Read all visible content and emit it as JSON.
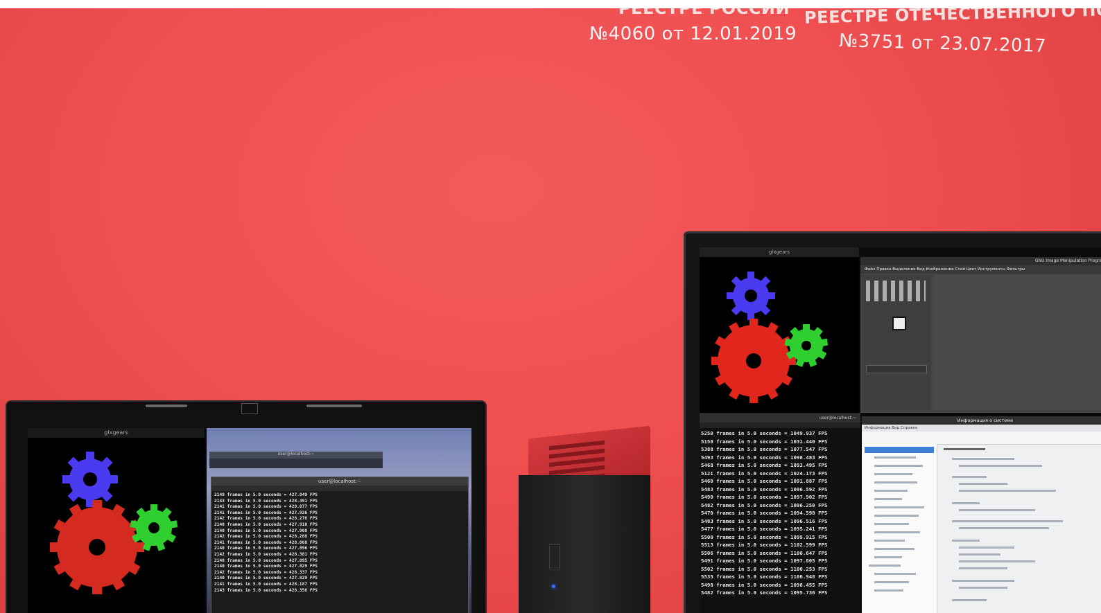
{
  "banner": {
    "left": {
      "cut_text": "РЕЕСТРЕ РОССИИ",
      "reg": "№4060 от 12.01.2019"
    },
    "right": {
      "cut_text": "РЕЕСТРЕ ОТЕЧЕСТВЕННОГО ПО",
      "reg": "№3751 от 23.07.2017"
    }
  },
  "left_screen": {
    "gears_title": "glxgears",
    "terminal_title": "user@localhost:~",
    "lines": [
      "2149 frames in 5.0 seconds = 427.849 FPS",
      "2143 frames in 5.0 seconds = 428.491 FPS",
      "2141 frames in 5.0 seconds = 428.077 FPS",
      "2141 frames in 5.0 seconds = 427.926 FPS",
      "2142 frames in 5.0 seconds = 428.276 FPS",
      "2140 frames in 5.0 seconds = 427.910 FPS",
      "2140 frames in 5.0 seconds = 427.908 FPS",
      "2142 frames in 5.0 seconds = 428.288 FPS",
      "2141 frames in 5.0 seconds = 428.068 FPS",
      "2140 frames in 5.0 seconds = 427.896 FPS",
      "2142 frames in 5.0 seconds = 428.381 FPS",
      "2140 frames in 5.0 seconds = 427.895 FPS",
      "2140 frames in 5.0 seconds = 427.829 FPS",
      "2142 frames in 5.0 seconds = 428.337 FPS",
      "2140 frames in 5.0 seconds = 427.829 FPS",
      "2141 frames in 5.0 seconds = 428.187 FPS",
      "2143 frames in 5.0 seconds = 428.356 FPS"
    ]
  },
  "right_screen": {
    "gears_title": "glxgears",
    "gimp_title": "GNU Image Manipulation Program",
    "gimp_menu": "Файл  Правка  Выделение  Вид  Изображение  Слой  Цвет  Инструменты  Фильтры",
    "sysinfo_title": "Информация о системе",
    "sysinfo_menu": "Информация  Вид  Справка",
    "terminal_title": "user@localhost:~",
    "lines": [
      "5250 frames in 5.0 seconds = 1049.937 FPS",
      "5158 frames in 5.0 seconds = 1031.440 FPS",
      "5388 frames in 5.0 seconds = 1077.547 FPS",
      "5493 frames in 5.0 seconds = 1098.483 FPS",
      "5468 frames in 5.0 seconds = 1093.495 FPS",
      "5121 frames in 5.0 seconds = 1024.173 FPS",
      "5460 frames in 5.0 seconds = 1091.887 FPS",
      "5483 frames in 5.0 seconds = 1096.592 FPS",
      "5490 frames in 5.0 seconds = 1097.902 FPS",
      "5482 frames in 5.0 seconds = 1096.250 FPS",
      "5470 frames in 5.0 seconds = 1094.598 FPS",
      "5483 frames in 5.0 seconds = 1096.516 FPS",
      "5477 frames in 5.0 seconds = 1095.241 FPS",
      "5500 frames in 5.0 seconds = 1099.915 FPS",
      "5513 frames in 5.0 seconds = 1102.599 FPS",
      "5506 frames in 5.0 seconds = 1100.647 FPS",
      "5491 frames in 5.0 seconds = 1097.805 FPS",
      "5502 frames in 5.0 seconds = 1100.253 FPS",
      "5535 frames in 5.0 seconds = 1106.948 FPS",
      "5498 frames in 5.0 seconds = 1098.455 FPS",
      "5482 frames in 5.0 seconds = 1095.736 FPS"
    ]
  },
  "colors": {
    "wall": "#ef4f51",
    "gear_red": "#e0261d",
    "gear_green": "#2fcf2f",
    "gear_blue": "#4a3af0",
    "pc_red": "#c8282e"
  }
}
